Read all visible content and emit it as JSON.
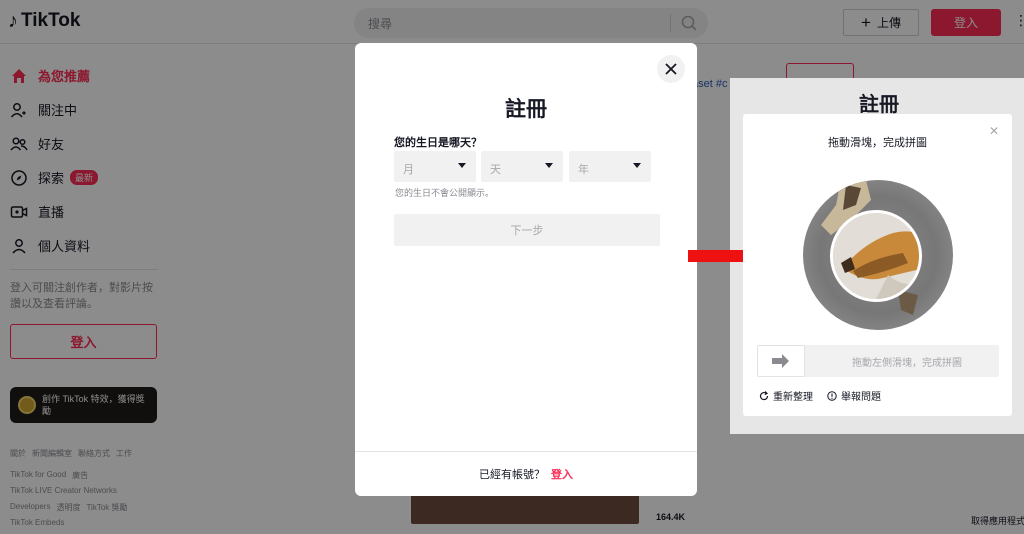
{
  "brand": {
    "name": "TikTok",
    "accent": "#fe2c55"
  },
  "header": {
    "search_placeholder": "搜尋",
    "upload_label": "上傳",
    "login_label": "登入"
  },
  "sidebar": {
    "items": [
      {
        "label": "為您推薦",
        "icon": "home-icon",
        "active": true
      },
      {
        "label": "關注中",
        "icon": "user-follow-icon"
      },
      {
        "label": "好友",
        "icon": "friends-icon"
      },
      {
        "label": "探索",
        "icon": "compass-icon",
        "badge": "最新"
      },
      {
        "label": "直播",
        "icon": "live-icon"
      },
      {
        "label": "個人資料",
        "icon": "profile-icon"
      }
    ],
    "login_hint": "登入可關注創作者，對影片按讚以及查看評論。",
    "login_button": "登入",
    "effect_banner": "創作 TikTok 特效，獲得獎勵",
    "footer_rows": [
      [
        "關於",
        "新聞編輯室",
        "聯絡方式",
        "工作"
      ],
      [
        "TikTok for Good",
        "廣告"
      ],
      [
        "TikTok LIVE Creator Networks"
      ],
      [
        "Developers",
        "透明度",
        "TikTok 獎勵"
      ],
      [
        "TikTok Embeds"
      ]
    ]
  },
  "background": {
    "hashtag": "aset #c",
    "video_count": "164.4K",
    "get_app": "取得應用程式",
    "panel_title": "註冊"
  },
  "signup_modal": {
    "title": "註冊",
    "birthday_question": "您的生日是哪天？",
    "month_placeholder": "月",
    "day_placeholder": "天",
    "year_placeholder": "年",
    "birthday_note": "您的生日不會公開顯示。",
    "next_button": "下一步",
    "have_account": "已經有帳號？",
    "login_link": "登入"
  },
  "captcha": {
    "title": "拖動滑塊，完成拼圖",
    "slider_hint": "拖動左側滑塊，完成拼圖",
    "refresh": "重新整理",
    "report": "舉報問題"
  },
  "arrow_color": "#ee1111"
}
